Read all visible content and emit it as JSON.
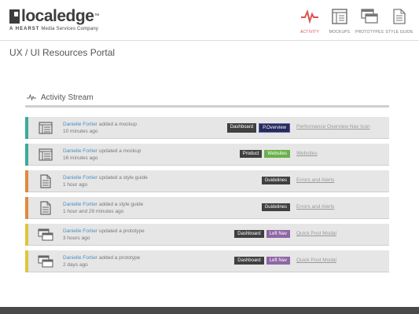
{
  "header": {
    "logo_text": "localedge",
    "logo_tm": "™",
    "logo_sub_brand": "A HEARST",
    "logo_sub_rest": "Media Services Company"
  },
  "nav": [
    {
      "label": "ACTIVITY",
      "icon": "activity-icon",
      "active": true
    },
    {
      "label": "MOCKUPS",
      "icon": "mockup-icon",
      "active": false
    },
    {
      "label": "PROTOTYPES",
      "icon": "prototype-icon",
      "active": false
    },
    {
      "label": "STYLE GUIDE",
      "icon": "style-guide-icon",
      "active": false
    }
  ],
  "page_title": "UX / UI Resources Portal",
  "stream": {
    "title": "Activity Stream",
    "items": [
      {
        "user": "Danielle Fortier",
        "action": "added a mockup",
        "time": "10 minutes ago",
        "type": "mockup",
        "bar_color": "#3aab9a",
        "tags": [
          {
            "label": "Dashboard",
            "style": "dark"
          },
          {
            "label": "P.Overview",
            "style": "navy"
          }
        ],
        "link": "Performance Overview Nav Icon"
      },
      {
        "user": "Danielle Fortier",
        "action": "updated a mockup",
        "time": "16 minutes ago",
        "type": "mockup",
        "bar_color": "#3aab9a",
        "tags": [
          {
            "label": "Product",
            "style": "dark"
          },
          {
            "label": "Websites",
            "style": "green"
          }
        ],
        "link": "Websites"
      },
      {
        "user": "Danielle Fortier",
        "action": "updated a style guide",
        "time": "1 hour ago",
        "type": "style-guide",
        "bar_color": "#e08a3c",
        "tags": [
          {
            "label": "Guidelines",
            "style": "dark"
          }
        ],
        "link": "Errors and Alerts"
      },
      {
        "user": "Danielle Fortier",
        "action": "added a style guide",
        "time": "1 hour and 29 minutes ago",
        "type": "style-guide",
        "bar_color": "#e08a3c",
        "tags": [
          {
            "label": "Guidelines",
            "style": "dark"
          }
        ],
        "link": "Errors and Alerts"
      },
      {
        "user": "Danielle Fortier",
        "action": "updated a prototype",
        "time": "3 hours ago",
        "type": "prototype",
        "bar_color": "#e0c43c",
        "tags": [
          {
            "label": "Dashboard",
            "style": "dark"
          },
          {
            "label": "Left Nav",
            "style": "purple"
          }
        ],
        "link": "Quick Post Modal"
      },
      {
        "user": "Danielle Fortier",
        "action": "added a prototype",
        "time": "2 days ago",
        "type": "prototype",
        "bar_color": "#e0c43c",
        "tags": [
          {
            "label": "Dashboard",
            "style": "dark"
          },
          {
            "label": "Left Nav",
            "style": "purple"
          }
        ],
        "link": "Quick Post Modal"
      }
    ]
  }
}
